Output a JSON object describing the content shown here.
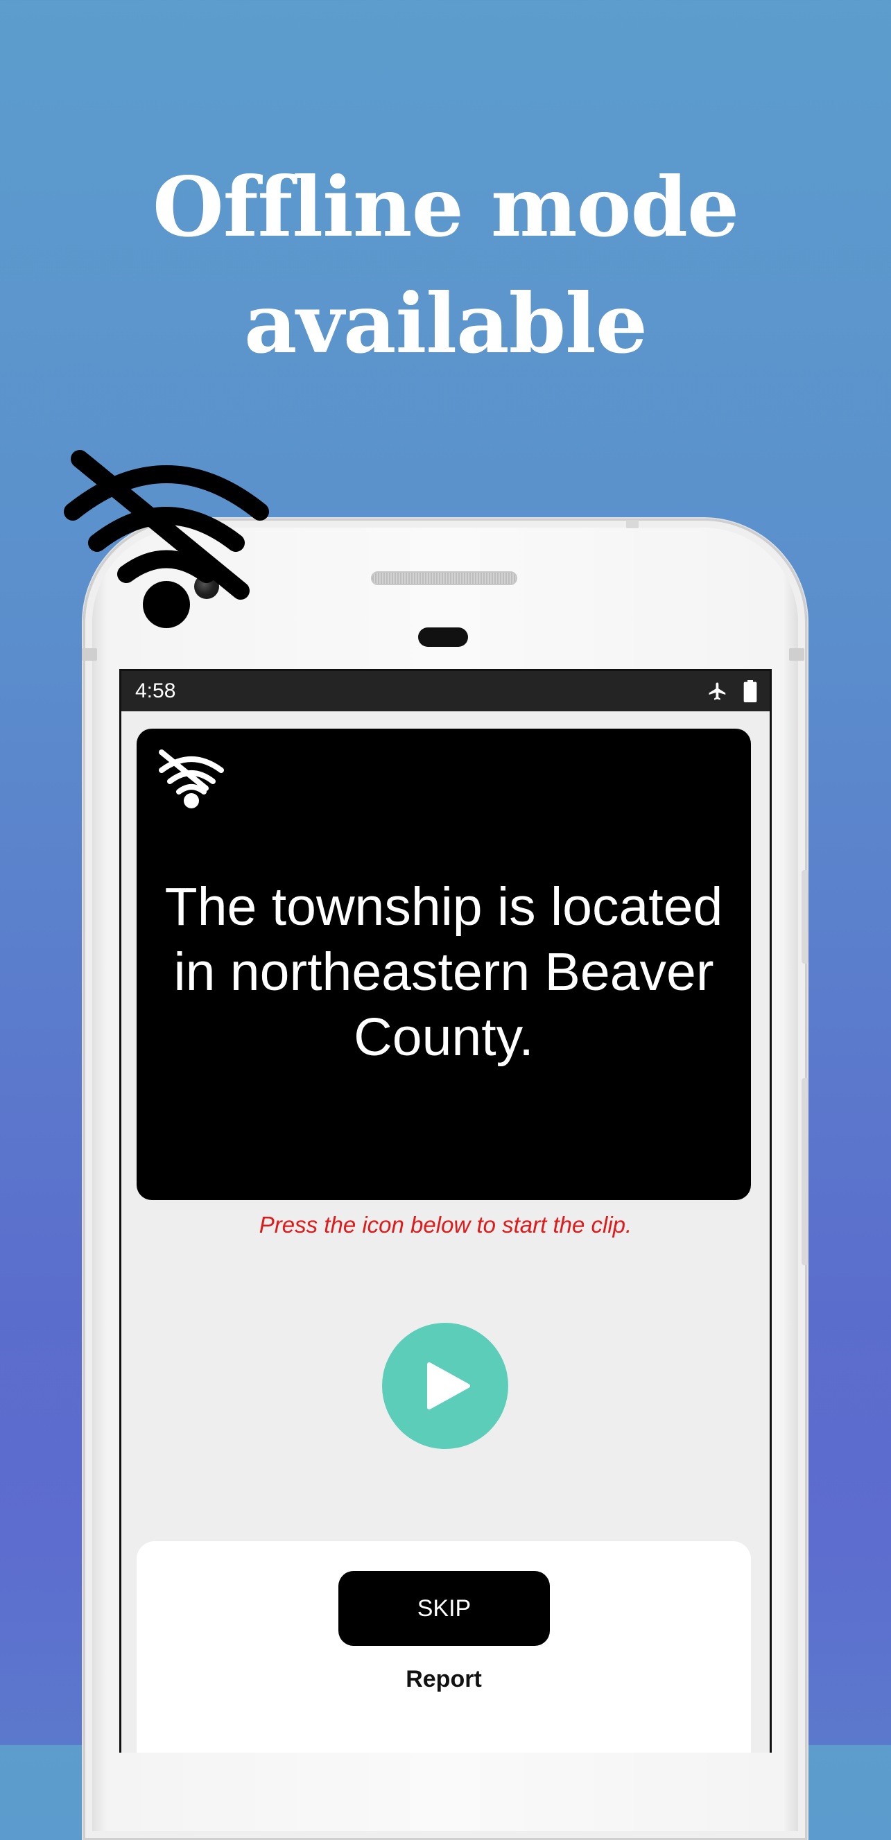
{
  "headline": {
    "line1": "Offline mode",
    "line2": "available"
  },
  "status_bar": {
    "time": "4:58",
    "icons": [
      "airplane-icon",
      "battery-icon"
    ]
  },
  "overlay_icon": "wifi-off-icon",
  "card": {
    "icon": "wifi-off-icon",
    "sentence": "The township is located in northeastern Beaver County."
  },
  "hint": "Press the icon below to start the clip.",
  "play_button": {
    "icon": "play-icon"
  },
  "actions": {
    "skip_label": "SKIP",
    "report_label": "Report"
  },
  "colors": {
    "background_top": "#5c9dcd",
    "background_bottom": "#5b6dcc",
    "play_button": "#5ccdb9",
    "hint_text": "#e01919",
    "card": "#000000"
  }
}
